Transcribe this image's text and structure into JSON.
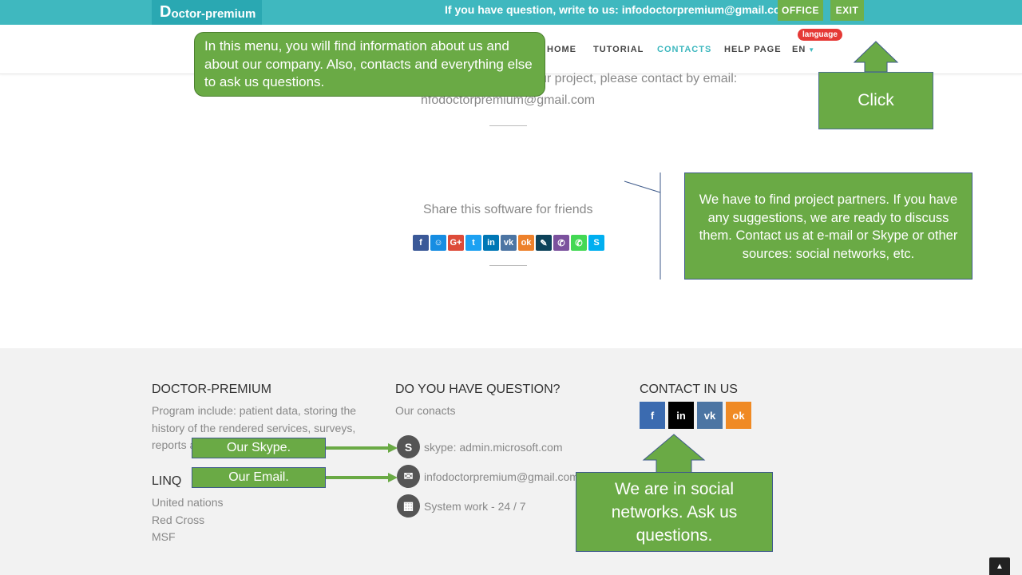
{
  "topbar": {
    "logo_initial": "D",
    "logo_rest": "octor-premium",
    "question": "If you have question, write to us: infodoctorpremium@gmail.com",
    "office_label": "OFFICE",
    "exit_label": "EXIT"
  },
  "nav": {
    "items": [
      {
        "label": "HOME"
      },
      {
        "label": "TUTORIAL"
      },
      {
        "label": "CONTACTS",
        "active": true
      },
      {
        "label": "HELP PAGE"
      }
    ],
    "language_label": "EN",
    "language_badge": "language"
  },
  "main": {
    "email_line_1": "ur project, please contact by email:",
    "email_line_2": "nfodoctorpremium@gmail.com",
    "share_title": "Share this software for friends",
    "share_icons": [
      {
        "icon": "facebook-icon",
        "glyph": "f",
        "color": "#3b5998"
      },
      {
        "icon": "moimir-icon",
        "glyph": "☺",
        "color": "#168de2"
      },
      {
        "icon": "google-plus-icon",
        "glyph": "G+",
        "color": "#dd4b39"
      },
      {
        "icon": "twitter-icon",
        "glyph": "t",
        "color": "#1da1f2"
      },
      {
        "icon": "linkedin-icon",
        "glyph": "in",
        "color": "#0077b5"
      },
      {
        "icon": "vk-icon",
        "glyph": "vk",
        "color": "#4c75a3"
      },
      {
        "icon": "odnoklassniki-icon",
        "glyph": "ok",
        "color": "#ed812b"
      },
      {
        "icon": "livejournal-icon",
        "glyph": "✎",
        "color": "#0d425a"
      },
      {
        "icon": "viber-icon",
        "glyph": "✆",
        "color": "#7b519d"
      },
      {
        "icon": "whatsapp-icon",
        "glyph": "✆",
        "color": "#43d854"
      },
      {
        "icon": "skype-icon",
        "glyph": "S",
        "color": "#00aff0"
      }
    ]
  },
  "footer": {
    "about_head": "DOCTOR-PREMIUM",
    "about_text": "Program include: patient data, storing the history of the rendered services, surveys, reports and other fun",
    "linq_head": "LINQ",
    "linq_items": [
      "United nations",
      "Red Cross",
      "MSF"
    ],
    "question_head": "DO YOU HAVE QUESTION?",
    "question_sub": "Our conacts",
    "skype_text": "skype: admin.microsoft.com",
    "email_text": "infodoctorpremium@gmail.com",
    "work_text": "System work - 24 / 7",
    "contact_head": "CONTACT IN US",
    "social": [
      {
        "icon": "facebook-icon",
        "glyph": "f",
        "color": "#3b6bb0"
      },
      {
        "icon": "linkedin-icon",
        "glyph": "in",
        "color": "#000000"
      },
      {
        "icon": "vk-icon",
        "glyph": "vk",
        "color": "#4c75a3"
      },
      {
        "icon": "odnoklassniki-icon",
        "glyph": "ok",
        "color": "#f08a24"
      }
    ]
  },
  "callouts": {
    "menu": "In this menu, you will find information about us and about our company. Also, contacts and everything else to ask us questions.",
    "click": "Click",
    "partners": "We have to find project partners. If you have any suggestions, we are ready to discuss them. Contact us at e-mail or Skype or other sources: social networks, etc.",
    "social": "We are in social networks. Ask us questions.",
    "skype": "Our Skype.",
    "email": "Our Email."
  },
  "colors": {
    "accent": "#3fb8bf",
    "callout_green": "#6aaa45",
    "button_green": "#6fb04a",
    "badge_red": "#e53935"
  }
}
